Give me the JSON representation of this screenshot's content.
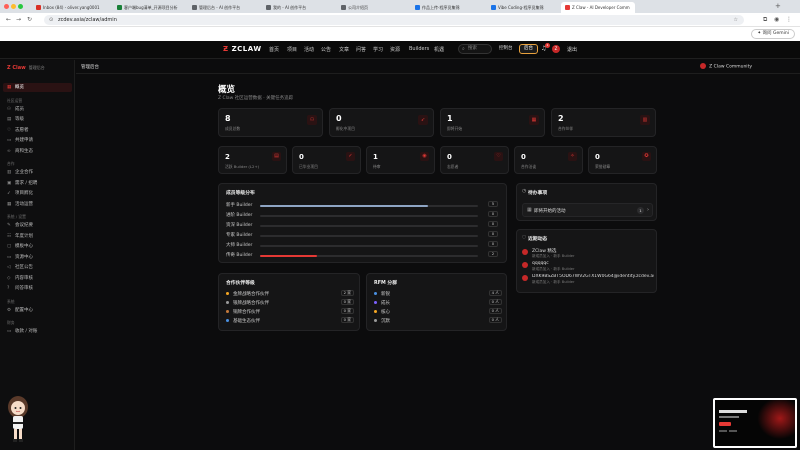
{
  "browser": {
    "tabs": [
      {
        "label": "Inbox (84) - oliver.yang0001",
        "color": "#d93025"
      },
      {
        "label": "客户端bug清单_开源项目分析",
        "color": "#188038"
      },
      {
        "label": "管理后台 - AI 创作平台",
        "color": "#5f6368"
      },
      {
        "label": "我的 - AI 创作平台",
        "color": "#5f6368"
      },
      {
        "label": "公司介绍页",
        "color": "#5f6368"
      },
      {
        "label": "作品上传-程序员集锦",
        "color": "#1a73e8"
      },
      {
        "label": "Vibe Coding-程序员集锦",
        "color": "#1a73e8"
      },
      {
        "label": "Z Claw - AI Developer Comm",
        "color": "#e53935"
      }
    ],
    "url": "zcdev.asia/zclaw/admin",
    "gemini_label": "询问 Gemini"
  },
  "site_nav": {
    "logo": "ZCLAW",
    "links": [
      "首页",
      "项目",
      "活动",
      "公告",
      "文章",
      "问答",
      "学习",
      "资源",
      "Builders",
      "机遇"
    ],
    "search_placeholder": "搜索",
    "control_label": "控制台",
    "admin_label": "后台",
    "notif_count": "1",
    "avatar_letter": "Z",
    "logout_label": "退出"
  },
  "sidebar": {
    "brand": "Z Claw",
    "brand_sub": "管理后台",
    "sections": [
      {
        "title": "",
        "items": [
          {
            "label": "概览",
            "icon": "grid-icon",
            "active": true
          }
        ]
      },
      {
        "title": "社区运营",
        "items": [
          {
            "label": "成员",
            "icon": "users-icon"
          },
          {
            "label": "等级",
            "icon": "chart-icon"
          },
          {
            "label": "志愿者",
            "icon": "heart-icon"
          },
          {
            "label": "共建申请",
            "icon": "doc-icon"
          },
          {
            "label": "商和生态",
            "icon": "link-icon"
          }
        ]
      },
      {
        "title": "合作",
        "items": [
          {
            "label": "企业合作",
            "icon": "building-icon"
          },
          {
            "label": "需求 / 招聘",
            "icon": "briefcase-icon"
          },
          {
            "label": "项目孵化",
            "icon": "rocket-icon"
          },
          {
            "label": "活动运营",
            "icon": "calendar-icon"
          }
        ]
      },
      {
        "title": "系统 / 设置",
        "items": [
          {
            "label": "会议纪要",
            "icon": "note-icon"
          },
          {
            "label": "年度计划",
            "icon": "plan-icon"
          },
          {
            "label": "模板中心",
            "icon": "template-icon"
          },
          {
            "label": "资源中心",
            "icon": "folder-icon"
          },
          {
            "label": "社区公告",
            "icon": "megaphone-icon"
          },
          {
            "label": "内容审核",
            "icon": "shield-icon"
          },
          {
            "label": "问答审核",
            "icon": "question-icon"
          }
        ]
      },
      {
        "title": "系统",
        "items": [
          {
            "label": "配置中心",
            "icon": "gear-icon"
          }
        ]
      },
      {
        "title": "财务",
        "items": [
          {
            "label": "收款 / 对账",
            "icon": "wallet-icon"
          }
        ]
      }
    ]
  },
  "header": {
    "title": "管理后台",
    "community_label": "Z Claw Community"
  },
  "overview": {
    "title": "概览",
    "subtitle": "Z Claw 社区运营数据 · 关键任务追踪",
    "stats_big": [
      {
        "value": "8",
        "label": "成员总数",
        "icon": "users-icon"
      },
      {
        "value": "0",
        "label": "孵化中项目",
        "icon": "rocket-icon"
      },
      {
        "value": "1",
        "label": "即将开始",
        "icon": "calendar-icon"
      },
      {
        "value": "2",
        "label": "合作伙伴",
        "icon": "building-icon"
      }
    ],
    "stats_small": [
      {
        "value": "2",
        "label": "活跃 Builder (L2+)",
        "icon": "chart-icon"
      },
      {
        "value": "0",
        "label": "已毕业项目",
        "icon": "check-icon"
      },
      {
        "value": "1",
        "label": "待审",
        "icon": "eye-icon"
      },
      {
        "value": "0",
        "label": "志愿者",
        "icon": "heart-icon"
      },
      {
        "value": "0",
        "label": "合作洽谈",
        "icon": "handshake-icon"
      },
      {
        "value": "0",
        "label": "荣誉勋章",
        "icon": "medal-icon"
      }
    ]
  },
  "level_dist": {
    "title": "成员等级分布",
    "rows": [
      {
        "name": "新手 Builder",
        "count": "5",
        "fill": 0.77,
        "color": "#8ea5c4"
      },
      {
        "name": "进阶 Builder",
        "count": "0",
        "fill": 0,
        "color": "#8ea5c4"
      },
      {
        "name": "资深 Builder",
        "count": "0",
        "fill": 0,
        "color": "#8ea5c4"
      },
      {
        "name": "专家 Builder",
        "count": "0",
        "fill": 0,
        "color": "#8ea5c4"
      },
      {
        "name": "大师 Builder",
        "count": "0",
        "fill": 0,
        "color": "#8ea5c4"
      },
      {
        "name": "传奇 Builder",
        "count": "2",
        "fill": 0.26,
        "color": "#e53935"
      }
    ]
  },
  "partners": {
    "title": "合作伙伴等级",
    "rows": [
      {
        "name": "金牌战略合作伙伴",
        "count": "2 家",
        "color": "#f5a623"
      },
      {
        "name": "银牌战略合作伙伴",
        "count": "0 家",
        "color": "#9b9b9b"
      },
      {
        "name": "铜牌合作伙伴",
        "count": "0 家",
        "color": "#c57a3c"
      },
      {
        "name": "基础生态伙伴",
        "count": "0 家",
        "color": "#4a90e2"
      }
    ]
  },
  "rfm": {
    "title": "RFM 分群",
    "rows": [
      {
        "name": "新锐",
        "count": "4 人",
        "color": "#4a90e2"
      },
      {
        "name": "成长",
        "count": "0 人",
        "color": "#7b61ff"
      },
      {
        "name": "核心",
        "count": "0 人",
        "color": "#f5a623"
      },
      {
        "name": "沉默",
        "count": "0 人",
        "color": "#9b9b9b"
      }
    ]
  },
  "todo": {
    "title": "待办事项",
    "item": "即将开始的活动",
    "count": "1"
  },
  "activity": {
    "title": "近期动态",
    "items": [
      {
        "title": "ZClaw 精选",
        "sub": "新成员加入 · 新手 Builder"
      },
      {
        "title": "qqqqqc",
        "sub": "新成员加入 · 新手 Builder"
      },
      {
        "title": "DXK9BSZBT5OD67WV2GTX1W0G64@identity.zcdev.as...",
        "sub": "新成员加入 · 新手 Builder"
      }
    ]
  }
}
